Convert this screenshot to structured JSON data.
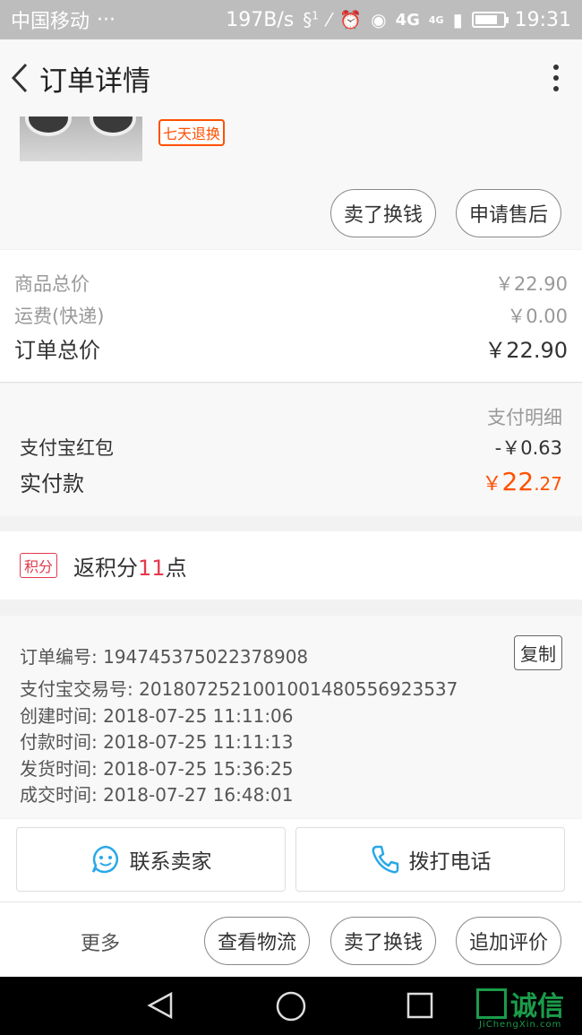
{
  "status_bar": {
    "carrier": "中国移动",
    "dots": "···",
    "speed": "197B/s",
    "sim_badge": "1",
    "network": "4G",
    "network_small": "4G",
    "battery_level": 0.8,
    "time": "19:31"
  },
  "nav": {
    "title": "订单详情"
  },
  "product": {
    "tag": "七天退换",
    "actions": [
      "卖了换钱",
      "申请售后"
    ]
  },
  "price": {
    "goods_label": "商品总价",
    "goods_value": "￥22.90",
    "shipping_label": "运费(快递)",
    "shipping_value": "￥0.00",
    "total_label": "订单总价",
    "total_value": "￥22.90"
  },
  "payment": {
    "detail_link": "支付明细",
    "redpack_label": "支付宝红包",
    "redpack_value": "-￥0.63",
    "paid_label": "实付款",
    "paid_symbol": "￥",
    "paid_int": "22",
    "paid_dec": ".27"
  },
  "points": {
    "tag": "积分",
    "prefix": "返积分",
    "num": "11",
    "suffix": "点"
  },
  "order_info": {
    "copy_label": "复制",
    "lines": [
      "订单编号: 194745375022378908",
      "支付宝交易号: 2018072521001001480556923537",
      "创建时间: 2018-07-25 11:11:06",
      "付款时间: 2018-07-25 11:11:13",
      "发货时间: 2018-07-25 15:36:25",
      "成交时间: 2018-07-27 16:48:01"
    ]
  },
  "contact": {
    "seller_label": "联系卖家",
    "call_label": "拨打电话"
  },
  "bottom_bar": {
    "more_label": "更多",
    "actions": [
      "查看物流",
      "卖了换钱",
      "追加评价"
    ]
  },
  "watermark": {
    "text": "诚信",
    "sub": "JiChengXin.com"
  },
  "colors": {
    "accent": "#ff5000",
    "points": "#e4394c",
    "chat_blue": "#2aa8e8"
  }
}
